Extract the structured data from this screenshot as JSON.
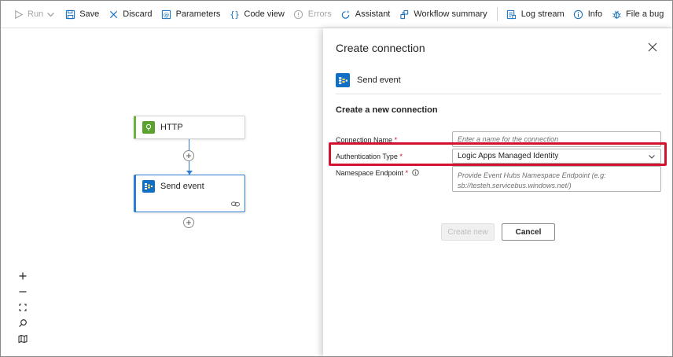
{
  "toolbar": {
    "run": "Run",
    "save": "Save",
    "discard": "Discard",
    "parameters": "Parameters",
    "code_view": "Code view",
    "errors": "Errors",
    "assistant": "Assistant",
    "workflow_summary": "Workflow summary",
    "log_stream": "Log stream",
    "info": "Info",
    "file_a_bug": "File a bug"
  },
  "canvas": {
    "nodes": [
      {
        "label": "HTTP",
        "icon": "http-trigger-icon"
      },
      {
        "label": "Send event",
        "icon": "event-hubs-icon"
      }
    ],
    "zoom_controls": [
      "zoom-in",
      "zoom-out",
      "fit-view",
      "search",
      "minimap"
    ]
  },
  "panel": {
    "title": "Create connection",
    "action_name": "Send event",
    "section_title": "Create a new connection",
    "fields": {
      "connection_name": {
        "label": "Connection Name",
        "required": "*",
        "placeholder": "Enter a name for the connection"
      },
      "auth_type": {
        "label": "Authentication Type",
        "required": "*",
        "value": "Logic Apps Managed Identity"
      },
      "namespace_endpoint": {
        "label": "Namespace Endpoint",
        "required": "*",
        "placeholder_line1": "Provide Event Hubs Namespace Endpoint (e.g:",
        "placeholder_line2": "sb://testeh.servicebus.windows.net/)"
      }
    },
    "buttons": {
      "create": "Create new",
      "cancel": "Cancel"
    }
  },
  "colors": {
    "accent": "#2d7cd6",
    "http_green": "#5aa130",
    "event_hubs_blue": "#0f6fc6",
    "highlight_red": "#d1132f",
    "required_red": "#c50f1f"
  }
}
